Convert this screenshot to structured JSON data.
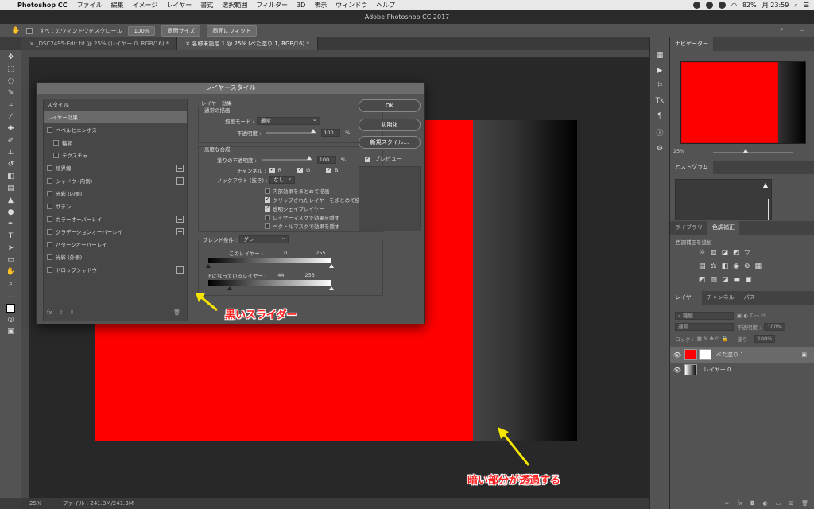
{
  "menubar": {
    "app_name": "Photoshop CC",
    "items": [
      "ファイル",
      "編集",
      "イメージ",
      "レイヤー",
      "書式",
      "選択範囲",
      "フィルター",
      "3D",
      "表示",
      "ウィンドウ",
      "ヘルプ"
    ],
    "battery": "82%",
    "clock": "月 23:59"
  },
  "window_title": "Adobe Photoshop CC 2017",
  "options": {
    "scroll_all_label": "すべてのウィンドウをスクロール",
    "btn_100": "100%",
    "btn_screen_size": "画面サイズ",
    "btn_fit": "画面にフィット"
  },
  "tabs": [
    {
      "label": "_DSC2495-Edit.tif @ 25% (レイヤー 0, RGB/16) *"
    },
    {
      "label": "名称未設定 1 @ 25% (べた塗り 1, RGB/16) *"
    }
  ],
  "status": {
    "zoom": "25%",
    "file": "ファイル : 241.3M/241.3M"
  },
  "dialog": {
    "title": "レイヤースタイル",
    "list_header": "スタイル",
    "list": [
      {
        "label": "レイヤー効果",
        "checkbox": false,
        "selected": true,
        "plus": false,
        "indent": false
      },
      {
        "label": "ベベルとエンボス",
        "checkbox": true,
        "selected": false,
        "plus": false,
        "indent": false
      },
      {
        "label": "輪郭",
        "checkbox": true,
        "selected": false,
        "plus": false,
        "indent": true
      },
      {
        "label": "テクスチャ",
        "checkbox": true,
        "selected": false,
        "plus": false,
        "indent": true
      },
      {
        "label": "境界線",
        "checkbox": true,
        "selected": false,
        "plus": true,
        "indent": false
      },
      {
        "label": "シャドウ (内側)",
        "checkbox": true,
        "selected": false,
        "plus": true,
        "indent": false
      },
      {
        "label": "光彩 (内側)",
        "checkbox": true,
        "selected": false,
        "plus": false,
        "indent": false
      },
      {
        "label": "サテン",
        "checkbox": true,
        "selected": false,
        "plus": false,
        "indent": false
      },
      {
        "label": "カラーオーバーレイ",
        "checkbox": true,
        "selected": false,
        "plus": true,
        "indent": false
      },
      {
        "label": "グラデーションオーバーレイ",
        "checkbox": true,
        "selected": false,
        "plus": true,
        "indent": false
      },
      {
        "label": "パターンオーバーレイ",
        "checkbox": true,
        "selected": false,
        "plus": false,
        "indent": false
      },
      {
        "label": "光彩 (外側)",
        "checkbox": true,
        "selected": false,
        "plus": false,
        "indent": false
      },
      {
        "label": "ドロップシャドウ",
        "checkbox": true,
        "selected": false,
        "plus": true,
        "indent": false
      }
    ],
    "fx_label": "fx",
    "settings": {
      "section_title": "レイヤー効果",
      "general_title": "通常の描画",
      "blend_mode_label": "描画モード :",
      "blend_mode_value": "通常",
      "opacity_label": "不透明度 :",
      "opacity_value": "100",
      "percent": "%",
      "advanced_title": "高度な合成",
      "fill_opacity_label": "塗りの不透明度 :",
      "fill_opacity_value": "100",
      "channel_label": "チャンネル :",
      "ch_r": "R",
      "ch_g": "G",
      "ch_b": "B",
      "knockout_label": "ノックアウト (抜き) :",
      "knockout_value": "なし",
      "opt1": "内部効果をまとめて描画",
      "opt2": "クリップされたレイヤーをまとめて描画",
      "opt3": "透明シェイプレイヤー",
      "opt4": "レイヤーマスクで効果を隠す",
      "opt5": "ベクトルマスクで効果を隠す",
      "blend_if_label": "ブレンド条件 :",
      "blend_if_value": "グレー",
      "this_layer_label": "このレイヤー :",
      "this_layer_low": "0",
      "this_layer_high": "255",
      "underlying_label": "下になっているレイヤー :",
      "underlying_low": "44",
      "underlying_high": "255"
    },
    "btn_ok": "OK",
    "btn_reset": "初期化",
    "btn_new_style": "新規スタイル...",
    "preview_label": "プレビュー"
  },
  "annotations": {
    "black_slider": "黒いスライダー",
    "dark_transparent": "暗い部分が透過する"
  },
  "panels": {
    "navigator_tab": "ナビゲーター",
    "nav_zoom": "25%",
    "histogram_tab": "ヒストグラム",
    "library_tab": "ライブラリ",
    "adjust_tab": "色調補正",
    "adjust_add": "色調補正を追加",
    "layers_tab": "レイヤー",
    "channels_tab": "チャンネル",
    "paths_tab": "パス",
    "kind_label": "種類",
    "blend_normal": "通常",
    "opacity_label": "不透明度 :",
    "opacity_value": "100%",
    "lock_label": "ロック :",
    "fill_label": "塗り :",
    "fill_value": "100%",
    "layers": [
      {
        "name": "べた塗り 1",
        "selected": true
      },
      {
        "name": "レイヤー 0",
        "selected": false
      }
    ]
  }
}
